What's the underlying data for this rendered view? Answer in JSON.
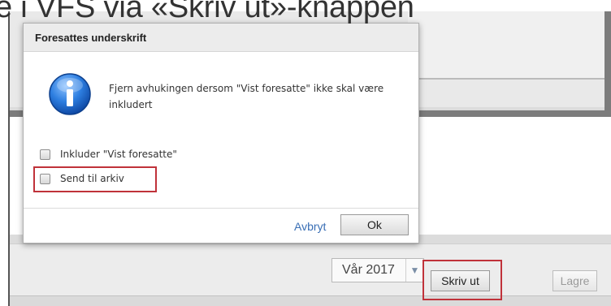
{
  "heading": {
    "text": "e i VFS via «Skriv ut»-knappen"
  },
  "dialog": {
    "title": "Foresattes underskrift",
    "icon": "info-icon",
    "message": "Fjern avhukingen dersom \"Vist foresatte\" ikke skal være inkludert",
    "options": [
      {
        "label": "Inkluder \"Vist foresatte\"",
        "checked": false
      },
      {
        "label": "Send til arkiv",
        "checked": false,
        "highlighted": true
      }
    ],
    "cancel_label": "Avbryt",
    "ok_label": "Ok"
  },
  "toolbar": {
    "term_value": "Vår 2017",
    "print_label": "Skriv ut",
    "save_label": "Lagre"
  },
  "colors": {
    "highlight": "#c0323a",
    "link": "#3a6fb5",
    "info_icon": "#1a64c8"
  }
}
